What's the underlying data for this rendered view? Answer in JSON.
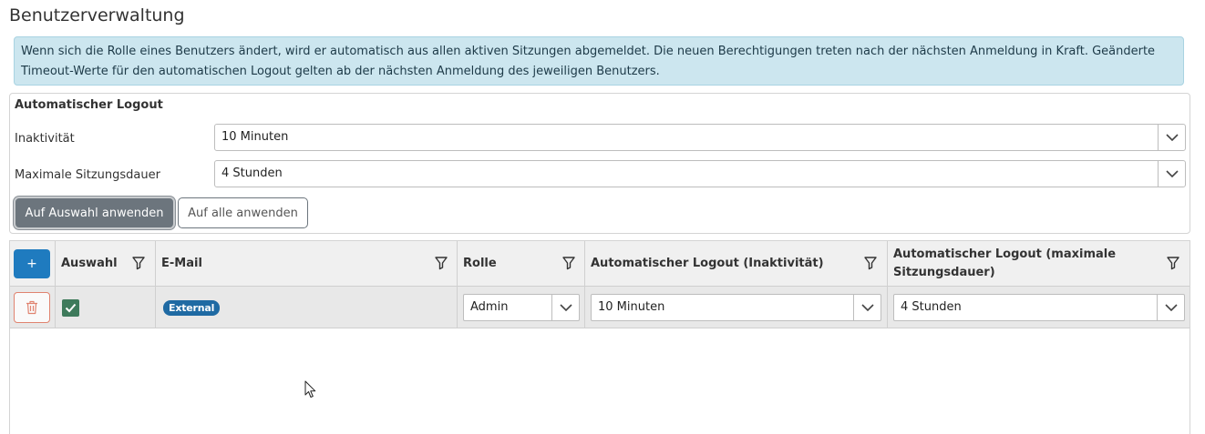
{
  "page": {
    "title": "Benutzerverwaltung"
  },
  "info": {
    "text": "Wenn sich die Rolle eines Benutzers ändert, wird er automatisch aus allen aktiven Sitzungen abgemeldet. Die neuen Berechtigungen treten nach der nächsten Anmeldung in Kraft. Geänderte Timeout-Werte für den automatischen Logout gelten ab der nächsten Anmeldung des jeweiligen Benutzers."
  },
  "logout": {
    "title": "Automatischer Logout",
    "inactivity_label": "Inaktivität",
    "inactivity_value": "10 Minuten",
    "max_session_label": "Maximale Sitzungsdauer",
    "max_session_value": "4 Stunden",
    "apply_selection_label": "Auf Auswahl anwenden",
    "apply_all_label": "Auf alle anwenden"
  },
  "grid": {
    "add_label": "+",
    "columns": {
      "selection": "Auswahl",
      "email": "E-Mail",
      "role": "Rolle",
      "logout_inactivity": "Automatischer Logout (Inaktivität)",
      "logout_max_line1": "Automatischer Logout (maximale",
      "logout_max_line2": "Sitzungsdauer)"
    },
    "rows": [
      {
        "selected": true,
        "email_badge": "External",
        "role": "Admin",
        "logout_inactivity": "10 Minuten",
        "logout_max": "4 Stunden"
      }
    ]
  },
  "colors": {
    "primary": "#1f7bbf",
    "secondary": "#6c757d",
    "info_bg": "#cce6ef",
    "danger": "#e0836f",
    "check": "#3e7a5b"
  },
  "icons": [
    "filter-icon",
    "trash-icon",
    "check-icon",
    "chevron-down-icon",
    "mouse-cursor-icon"
  ]
}
